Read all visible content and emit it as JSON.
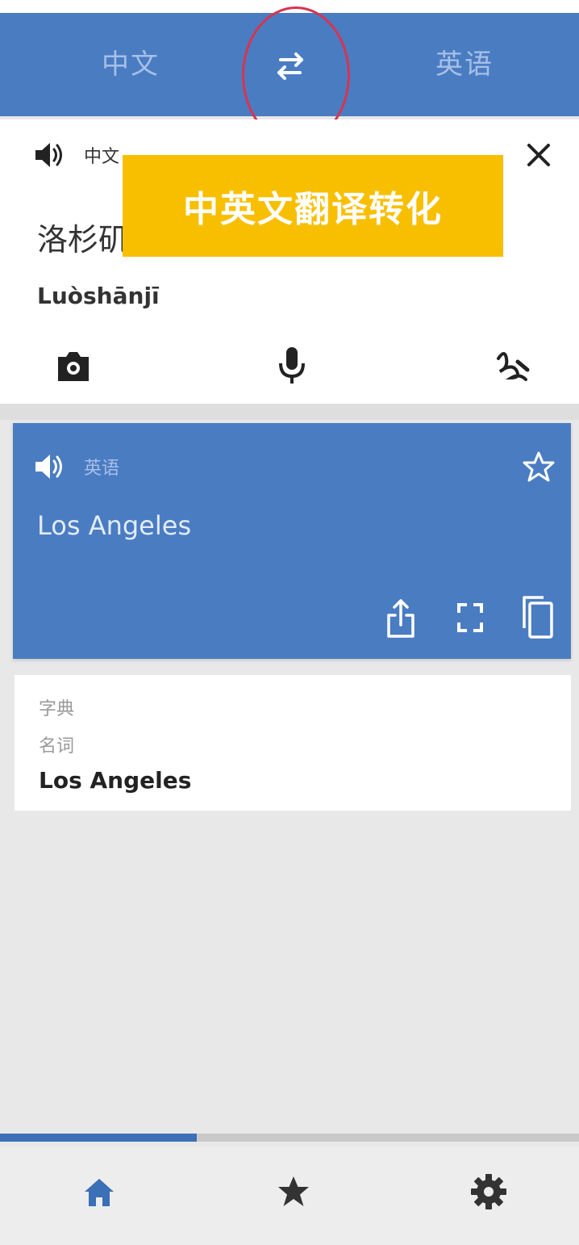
{
  "header": {
    "source_language": "中文",
    "target_language": "英语",
    "swap_icon": "swap-arrows-icon"
  },
  "input": {
    "language_label": "中文",
    "source_text": "洛杉矶",
    "pinyin": "Luòshānjī",
    "tools": [
      "camera-icon",
      "microphone-icon",
      "handwriting-icon"
    ]
  },
  "overlay": {
    "text": "中英文翻译转化"
  },
  "result": {
    "language_label": "英语",
    "translation": "Los Angeles",
    "actions": [
      "share-icon",
      "fullscreen-icon",
      "copy-icon"
    ]
  },
  "dictionary": {
    "label": "字典",
    "part_of_speech": "名词",
    "entry": "Los Angeles"
  },
  "progress": {
    "fraction": 0.34
  },
  "nav": {
    "items": [
      "home-icon",
      "star-icon",
      "settings-icon"
    ],
    "active": "home"
  },
  "colors": {
    "primary": "#4a7cc2",
    "banner": "#f8bf00",
    "highlight_ring": "#d7344f",
    "active_nav": "#3b6fb6"
  }
}
